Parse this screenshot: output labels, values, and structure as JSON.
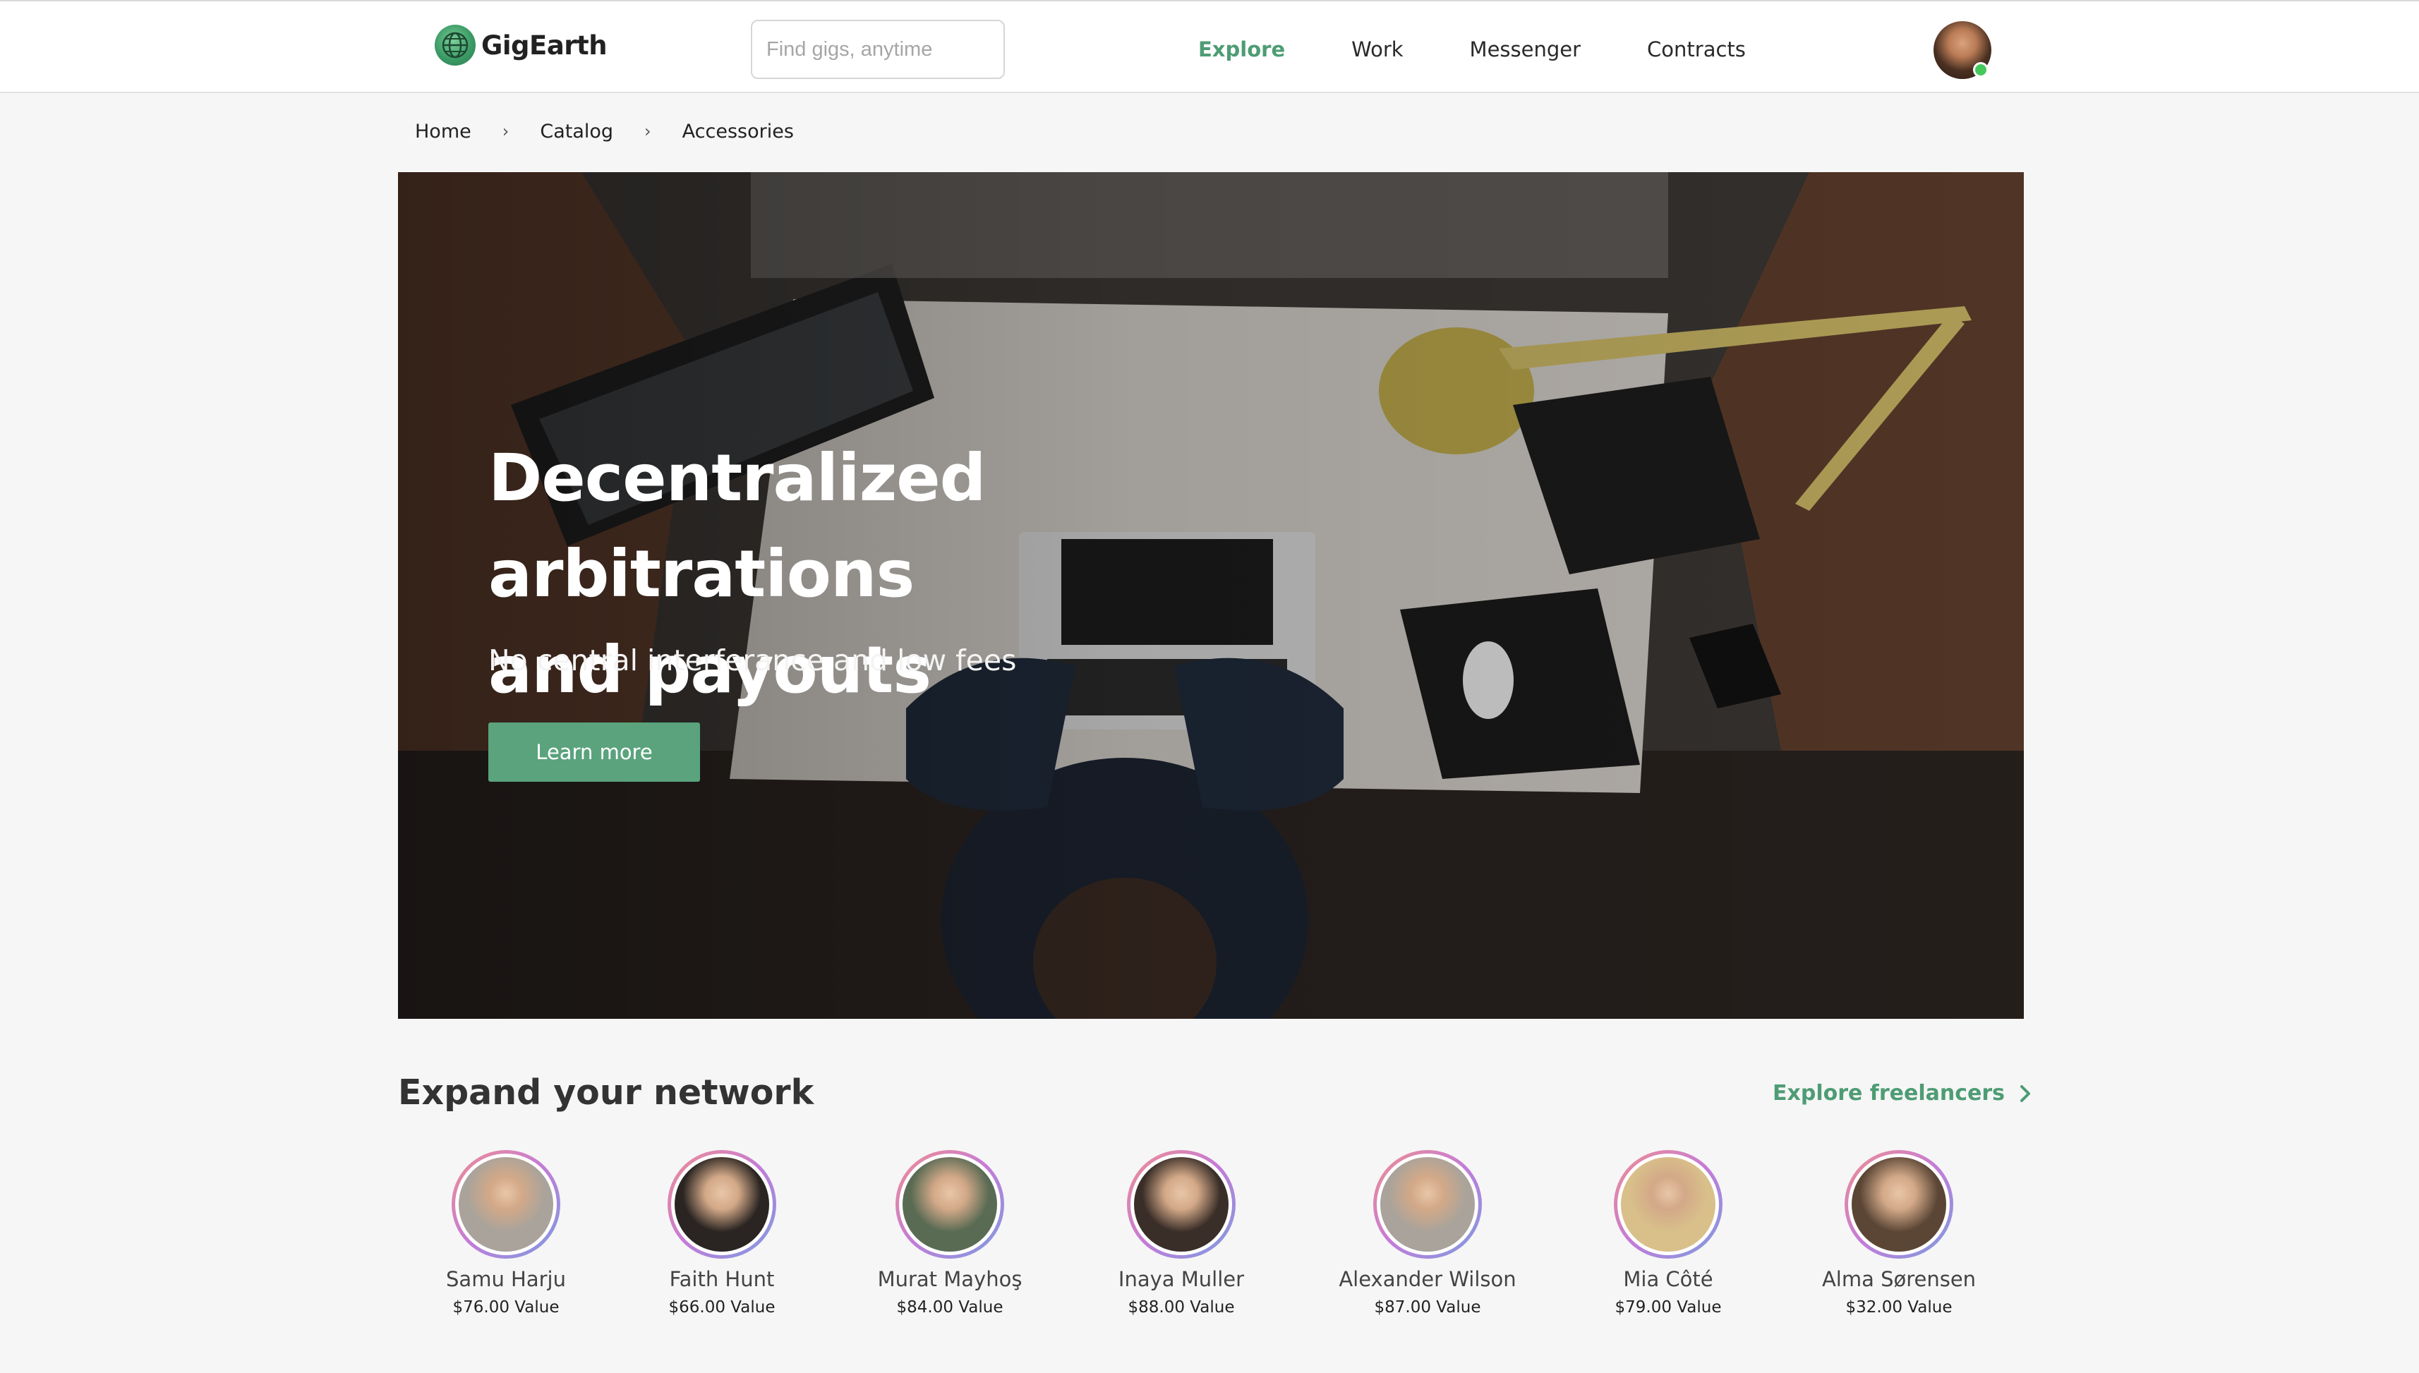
{
  "brand": {
    "name": "GigEarth",
    "accent": "#4e9c74",
    "button_color": "#5aa37d"
  },
  "search": {
    "placeholder": "Find gigs, anytime",
    "value": ""
  },
  "nav": {
    "items": [
      {
        "label": "Explore",
        "active": true
      },
      {
        "label": "Work",
        "active": false
      },
      {
        "label": "Messenger",
        "active": false
      },
      {
        "label": "Contracts",
        "active": false
      }
    ]
  },
  "user": {
    "status": "online",
    "status_color": "#45c85b"
  },
  "breadcrumb": [
    "Home",
    "Catalog",
    "Accessories"
  ],
  "hero": {
    "title_line1": "Decentralized arbitrations",
    "title_line2": "and payouts",
    "subtitle": "No central interferance and low fees",
    "cta_label": "Learn more"
  },
  "network": {
    "title": "Expand your network",
    "explore_label": "Explore freelancers",
    "people": [
      {
        "name": "Samu Harju",
        "value": "$76.00 Value",
        "photo_color": "#a9a39b"
      },
      {
        "name": "Faith Hunt",
        "value": "$66.00 Value",
        "photo_color": "#2a2522"
      },
      {
        "name": "Murat Mayhoş",
        "value": "$84.00 Value",
        "photo_color": "#5a6b54"
      },
      {
        "name": "Inaya Muller",
        "value": "$88.00 Value",
        "photo_color": "#3a2e28"
      },
      {
        "name": "Alexander Wilson",
        "value": "$87.00 Value",
        "photo_color": "#a9a39b"
      },
      {
        "name": "Mia Côté",
        "value": "$79.00 Value",
        "photo_color": "#d9c08a"
      },
      {
        "name": "Alma Sørensen",
        "value": "$32.00 Value",
        "photo_color": "#5b4636"
      }
    ]
  }
}
